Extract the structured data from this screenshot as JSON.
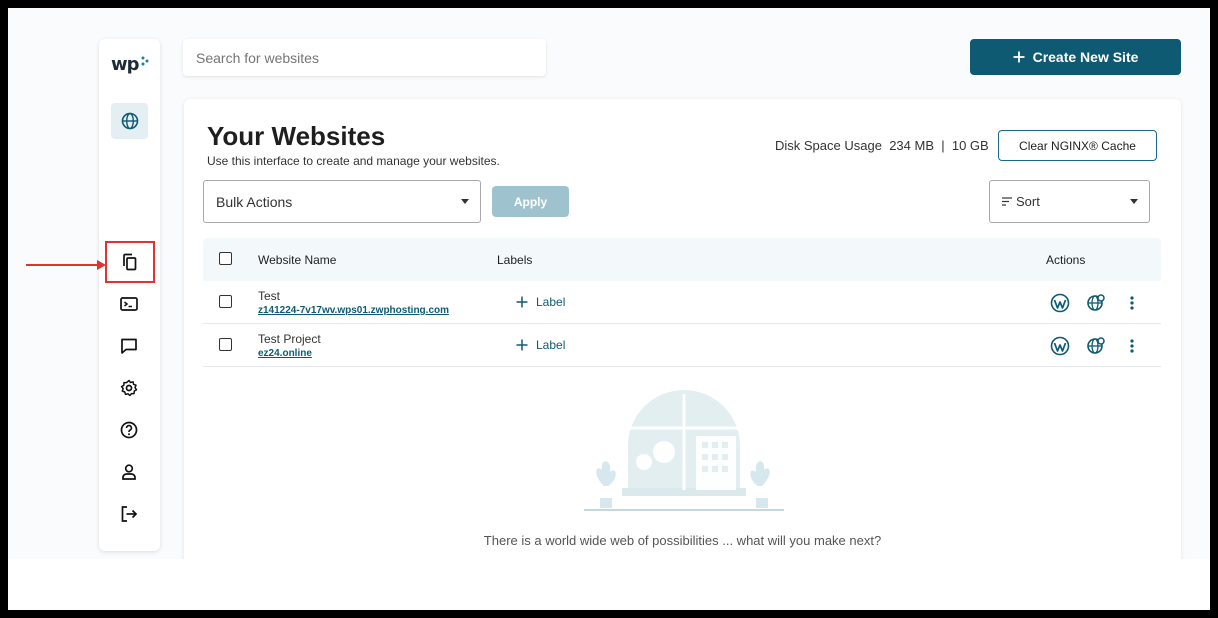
{
  "sidebar": {
    "logo": "wp",
    "items": [
      {
        "name": "websites",
        "icon": "globe-icon"
      },
      {
        "name": "copy",
        "icon": "copy-icon"
      },
      {
        "name": "terminal",
        "icon": "terminal-icon"
      },
      {
        "name": "messages",
        "icon": "chat-icon"
      },
      {
        "name": "settings",
        "icon": "gear-icon"
      },
      {
        "name": "help",
        "icon": "help-icon"
      },
      {
        "name": "account",
        "icon": "user-icon"
      },
      {
        "name": "logout",
        "icon": "logout-icon"
      }
    ]
  },
  "search": {
    "placeholder": "Search for websites"
  },
  "header": {
    "create_label": "Create New Site"
  },
  "main": {
    "title": "Your Websites",
    "subtitle": "Use this interface to create and manage your websites.",
    "disk_label": "Disk Space Usage",
    "disk_used": "234 MB",
    "disk_separator": "|",
    "disk_total": "10 GB",
    "clear_cache_label": "Clear NGINX® Cache",
    "bulk_actions_label": "Bulk Actions",
    "apply_label": "Apply",
    "sort_label": "Sort",
    "empty_message": "There is a world wide web of possibilities ... what will you make next?"
  },
  "table": {
    "columns": [
      "Website Name",
      "Labels",
      "Actions"
    ],
    "rows": [
      {
        "name": "Test",
        "url": "z141224-7v17wv.wps01.zwphosting.com",
        "label_action": "Label"
      },
      {
        "name": "Test Project",
        "url": "ez24.online",
        "label_action": "Label"
      }
    ]
  },
  "colors": {
    "accent": "#0e5a73",
    "apply_disabled": "#9fc3ce",
    "highlight": "#e0322e"
  }
}
